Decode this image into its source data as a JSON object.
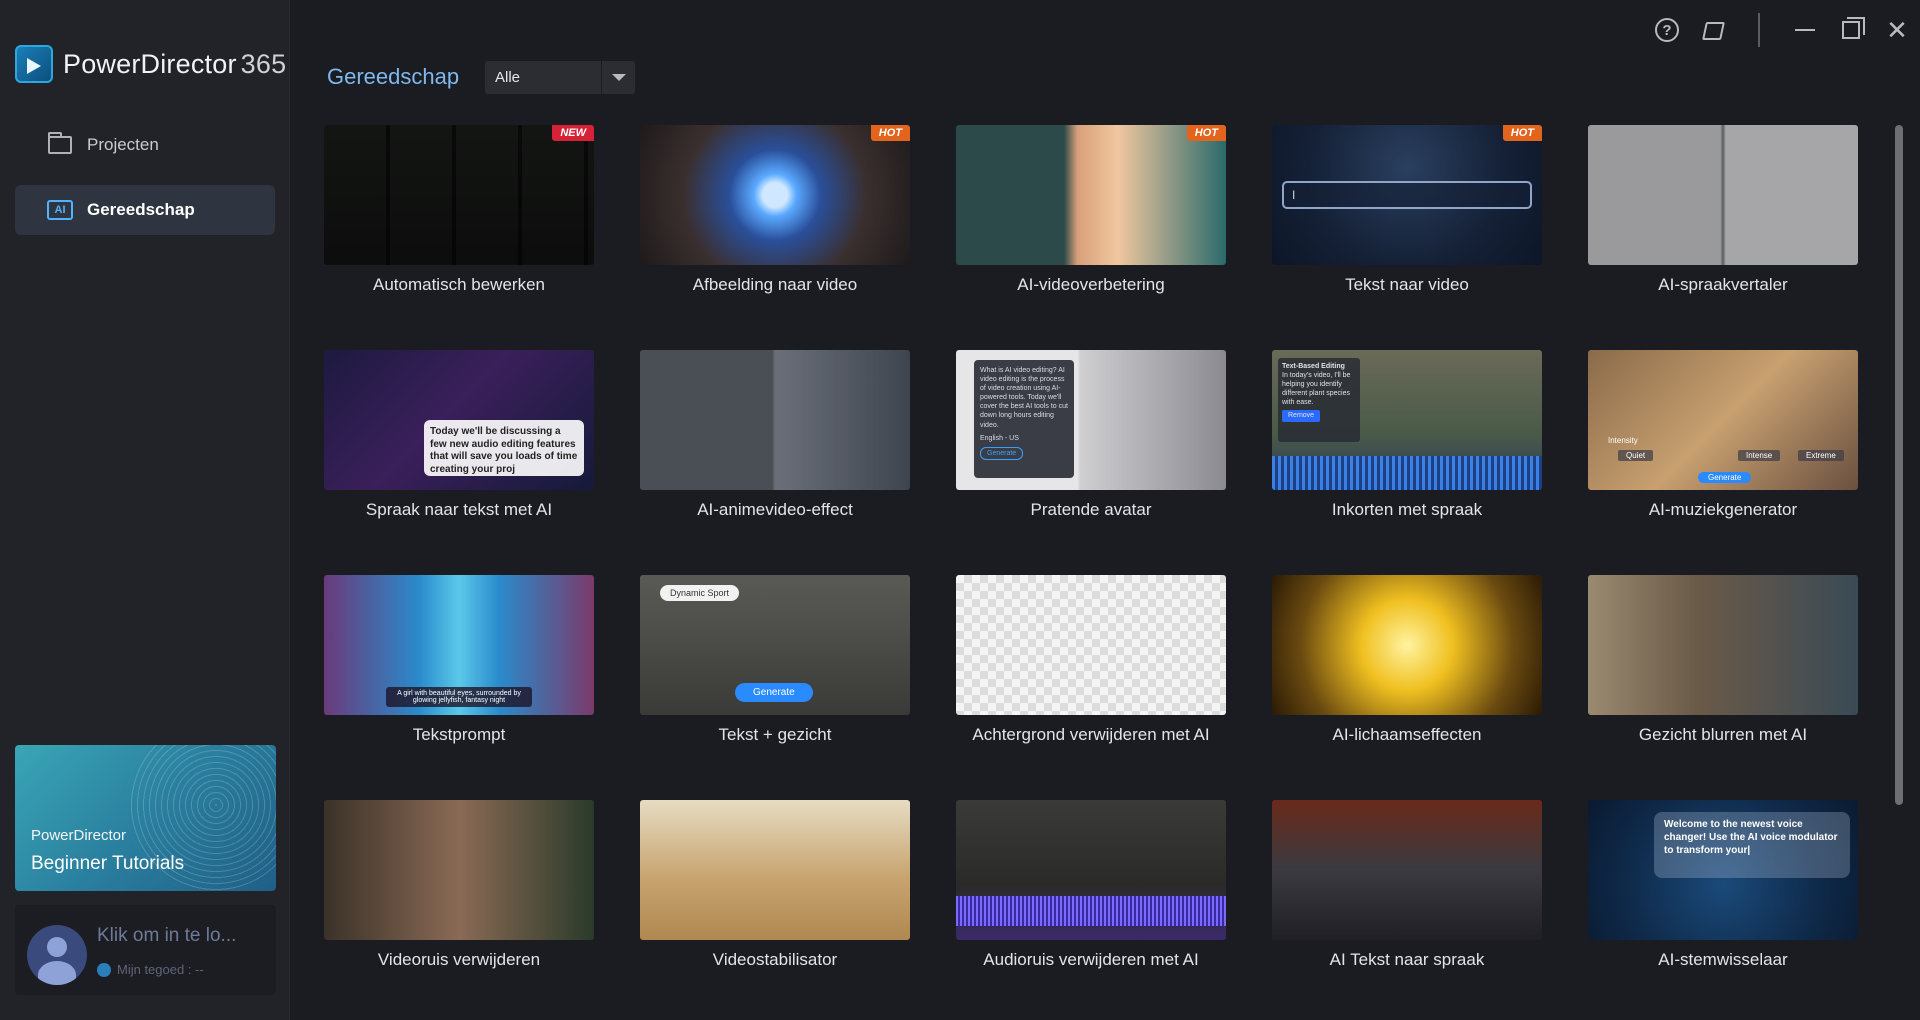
{
  "brand": {
    "name": "PowerDirector",
    "version": "365"
  },
  "sidebar": {
    "items": [
      {
        "label": "Projecten",
        "icon": "folder-icon"
      },
      {
        "label": "Gereedschap",
        "icon": "ai-icon"
      }
    ],
    "tutorial": {
      "line1": "PowerDirector",
      "line2": "Beginner Tutorials"
    },
    "account": {
      "login": "Klik om in te lo...",
      "credit": "Mijn tegoed : --"
    }
  },
  "main": {
    "title": "Gereedschap",
    "filter": {
      "selected": "Alle"
    }
  },
  "tools": [
    {
      "label": "Automatisch bewerken",
      "badge": "NEW"
    },
    {
      "label": "Afbeelding naar video",
      "badge": "HOT"
    },
    {
      "label": "AI-videoverbetering",
      "badge": "HOT"
    },
    {
      "label": "Tekst naar video",
      "badge": "HOT"
    },
    {
      "label": "AI-spraakvertaler",
      "badge": ""
    },
    {
      "label": "Spraak naar tekst met AI",
      "badge": ""
    },
    {
      "label": "AI-animevideo-effect",
      "badge": ""
    },
    {
      "label": "Pratende avatar",
      "badge": ""
    },
    {
      "label": "Inkorten met spraak",
      "badge": ""
    },
    {
      "label": "AI-muziekgenerator",
      "badge": ""
    },
    {
      "label": "Tekstprompt",
      "badge": ""
    },
    {
      "label": "Tekst + gezicht",
      "badge": ""
    },
    {
      "label": "Achtergrond verwijderen met AI",
      "badge": ""
    },
    {
      "label": "AI-lichaamseffecten",
      "badge": ""
    },
    {
      "label": "Gezicht blurren met AI",
      "badge": ""
    },
    {
      "label": "Videoruis verwijderen",
      "badge": ""
    },
    {
      "label": "Videostabilisator",
      "badge": ""
    },
    {
      "label": "Audioruis verwijderen met AI",
      "badge": ""
    },
    {
      "label": "AI Tekst naar spraak",
      "badge": ""
    },
    {
      "label": "AI-stemwisselaar",
      "badge": ""
    }
  ],
  "thumb_text": {
    "text2vid_input": "I",
    "speech_caption": "Today we'll be discussing a few new audio editing features that will save you loads of time creating your proj",
    "avatar_panel": "What is AI video editing? AI video editing is the process of video creation using AI-powered tools. Today we'll cover the best AI tools to cut down long hours editing video.",
    "avatar_lang": "English - US",
    "avatar_generate": "Generate",
    "trim_title": "Text-Based Editing",
    "trim_body": "In today's video, I'll be helping you identify different plant species with ease.",
    "trim_button": "Remove",
    "music_intensity": "Intensity",
    "music_options": [
      "Quiet",
      "Intense",
      "Extreme"
    ],
    "music_generate": "Generate",
    "prompt_caption": "A girl with beautiful eyes, surrounded by glowing jellyfish, fantasy night",
    "face_pill": "Dynamic Sport",
    "face_generate": "Generate",
    "voice_bubble": "Welcome to the newest voice changer! Use the AI voice modulator to transform your|"
  },
  "colors": {
    "accent": "#7fb8ef",
    "new_badge": "#d62236",
    "hot_badge": "#e3641c"
  }
}
